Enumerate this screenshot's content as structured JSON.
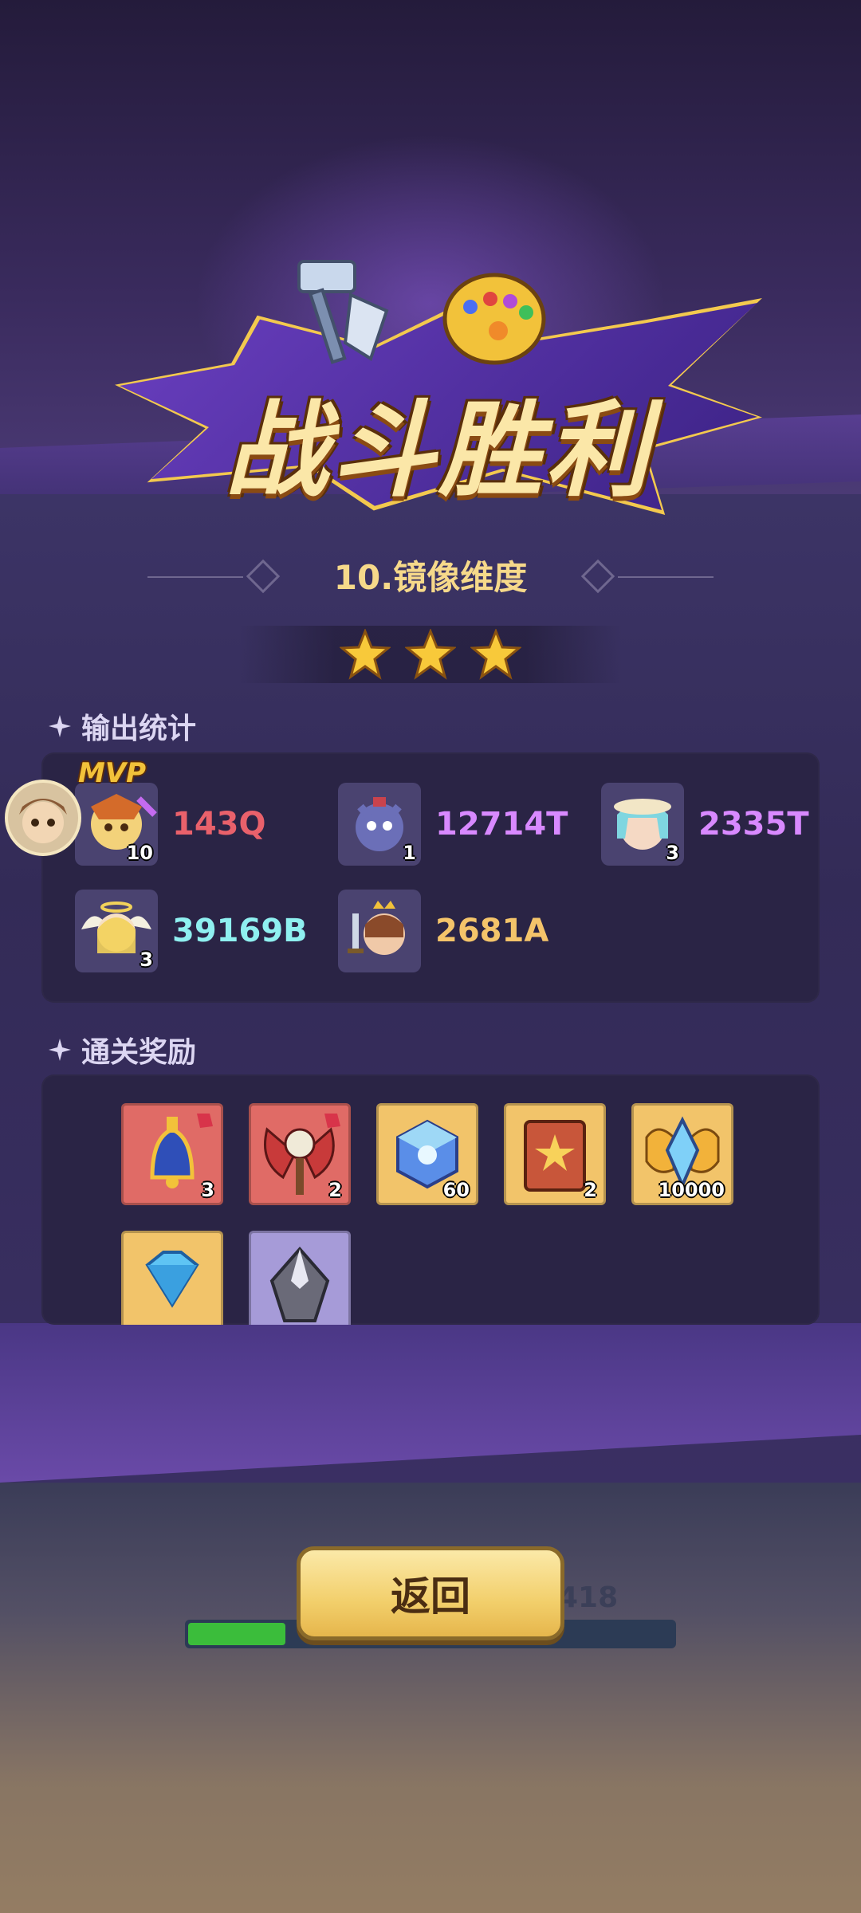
{
  "header": {
    "victory_title": "战斗胜利",
    "stage_title": "10.镜像维度",
    "stars": 3
  },
  "damage_section": {
    "title": "输出统计",
    "mvp_label": "MVP",
    "entries": [
      {
        "level": "10",
        "value": "143Q",
        "color": "#e9616b"
      },
      {
        "level": "1",
        "value": "12714T",
        "color": "#d889ff"
      },
      {
        "level": "3",
        "value": "2335T",
        "color": "#d889ff"
      },
      {
        "level": "3",
        "value": "39169B",
        "color": "#8ff0f0"
      },
      {
        "level": "",
        "value": "2681A",
        "color": "#f4c46a"
      }
    ]
  },
  "rewards_section": {
    "title": "通关奖励",
    "items": [
      {
        "qty": "3",
        "icon": "golden-bell-icon",
        "bg": "#e06b66"
      },
      {
        "qty": "2",
        "icon": "skull-axe-icon",
        "bg": "#e06b66"
      },
      {
        "qty": "60",
        "icon": "crystal-cube-icon",
        "bg": "#f2c46a"
      },
      {
        "qty": "2",
        "icon": "spell-book-icon",
        "bg": "#f2c46a"
      },
      {
        "qty": "10000",
        "icon": "gold-wing-badge-icon",
        "bg": "#f2c46a"
      },
      {
        "qty": "",
        "icon": "blue-diamond-icon",
        "bg": "#f2c46a"
      },
      {
        "qty": "",
        "icon": "silver-shard-icon",
        "bg": "#a69bd8"
      }
    ]
  },
  "footer": {
    "return_label": "返回",
    "hp_text": "418",
    "hp_progress": 0.2
  }
}
